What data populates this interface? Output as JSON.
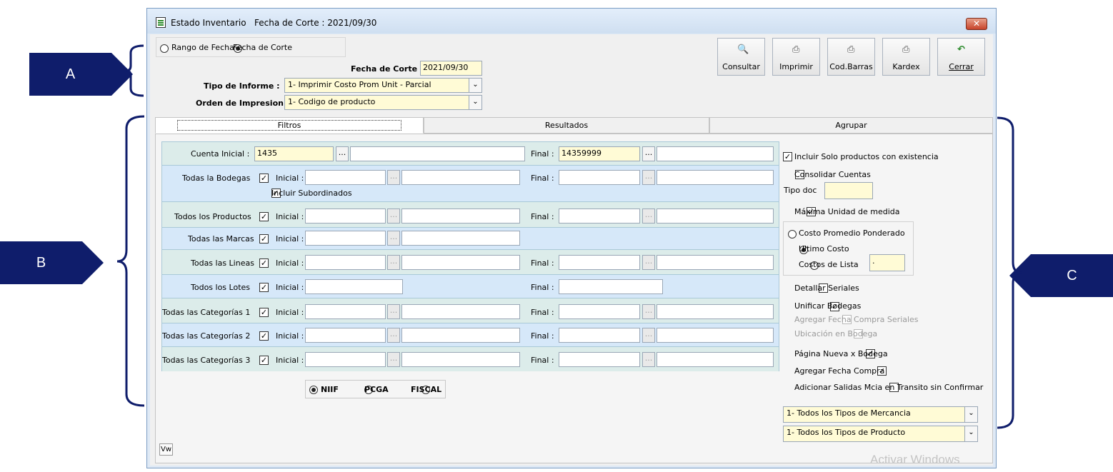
{
  "annotations": {
    "a": "A",
    "b": "B",
    "c": "C"
  },
  "window": {
    "title": "Estado Inventario",
    "title_date": "Fecha de Corte : 2021/09/30",
    "close_glyph": "✕"
  },
  "header": {
    "radio_rango": "Rango de Fechas",
    "radio_corte": "Fecha de Corte",
    "fecha_corte_label": "Fecha de Corte :",
    "fecha_corte_value": "2021/09/30",
    "tipo_informe_label": "Tipo de Informe :",
    "tipo_informe_value": "1-  Imprimir Costo Prom Unit - Parcial",
    "orden_label": "Orden de Impresion :",
    "orden_value": "1-  Codigo de producto"
  },
  "toolbar": {
    "consultar": "Consultar",
    "imprimir": "Imprimir",
    "codbarras": "Cod.Barras",
    "kardex": "Kardex",
    "cerrar": "Cerrar"
  },
  "tabs": {
    "filtros": "Filtros",
    "resultados": "Resultados",
    "agrupar": "Agrupar"
  },
  "filters": {
    "dots": "...",
    "inicial": "Inicial :",
    "final": "Final :",
    "cuenta_label": "Cuenta Inicial :",
    "cuenta_inicial": "1435",
    "cuenta_final": "14359999",
    "bodegas": "Todas la Bodegas",
    "subordinados": "Incluir Subordinados",
    "productos": "Todos los Productos",
    "marcas": "Todas las Marcas",
    "lineas": "Todas las Lineas",
    "lotes": "Todos los Lotes",
    "cat1": "Todas las Categorías 1",
    "cat2": "Todas las Categorías 2",
    "cat3": "Todas las Categorías 3"
  },
  "standards": {
    "niif": "NIIF",
    "pcga": "PCGA",
    "fiscal": "FISCAL"
  },
  "options": {
    "solo_existencia": "Incluir Solo productos con existencia",
    "consolidar": "Consolidar Cuentas",
    "tipo_doc": "Tipo doc",
    "maxima_unidad": "Máxima Unidad de medida",
    "costo_promedio": "Costo Promedio Ponderado",
    "ultimo_costo": "Ultimo Costo",
    "costos_lista": "Costos de Lista",
    "costos_lista_value": ".",
    "detallar_seriales": "Detallar Seriales",
    "unificar_bodegas": "Unificar Bodegas",
    "agregar_fecha_seriales": "Agregar Fecha Compra Seriales",
    "ubicacion_bodega": "Ubicación en Bodega",
    "pagina_nueva": "Página Nueva x Bodega",
    "agregar_fecha_compra": "Agregar Fecha Compra",
    "adicionar_salidas": "Adicionar Salidas Mcia en Transito sin Confirmar",
    "tipos_mercancia": "1-  Todos los Tipos de Mercancia",
    "tipos_producto": "1-  Todos los Tipos de Producto"
  },
  "footer": {
    "vw": "Vw",
    "watermark": "Activar Windows"
  }
}
